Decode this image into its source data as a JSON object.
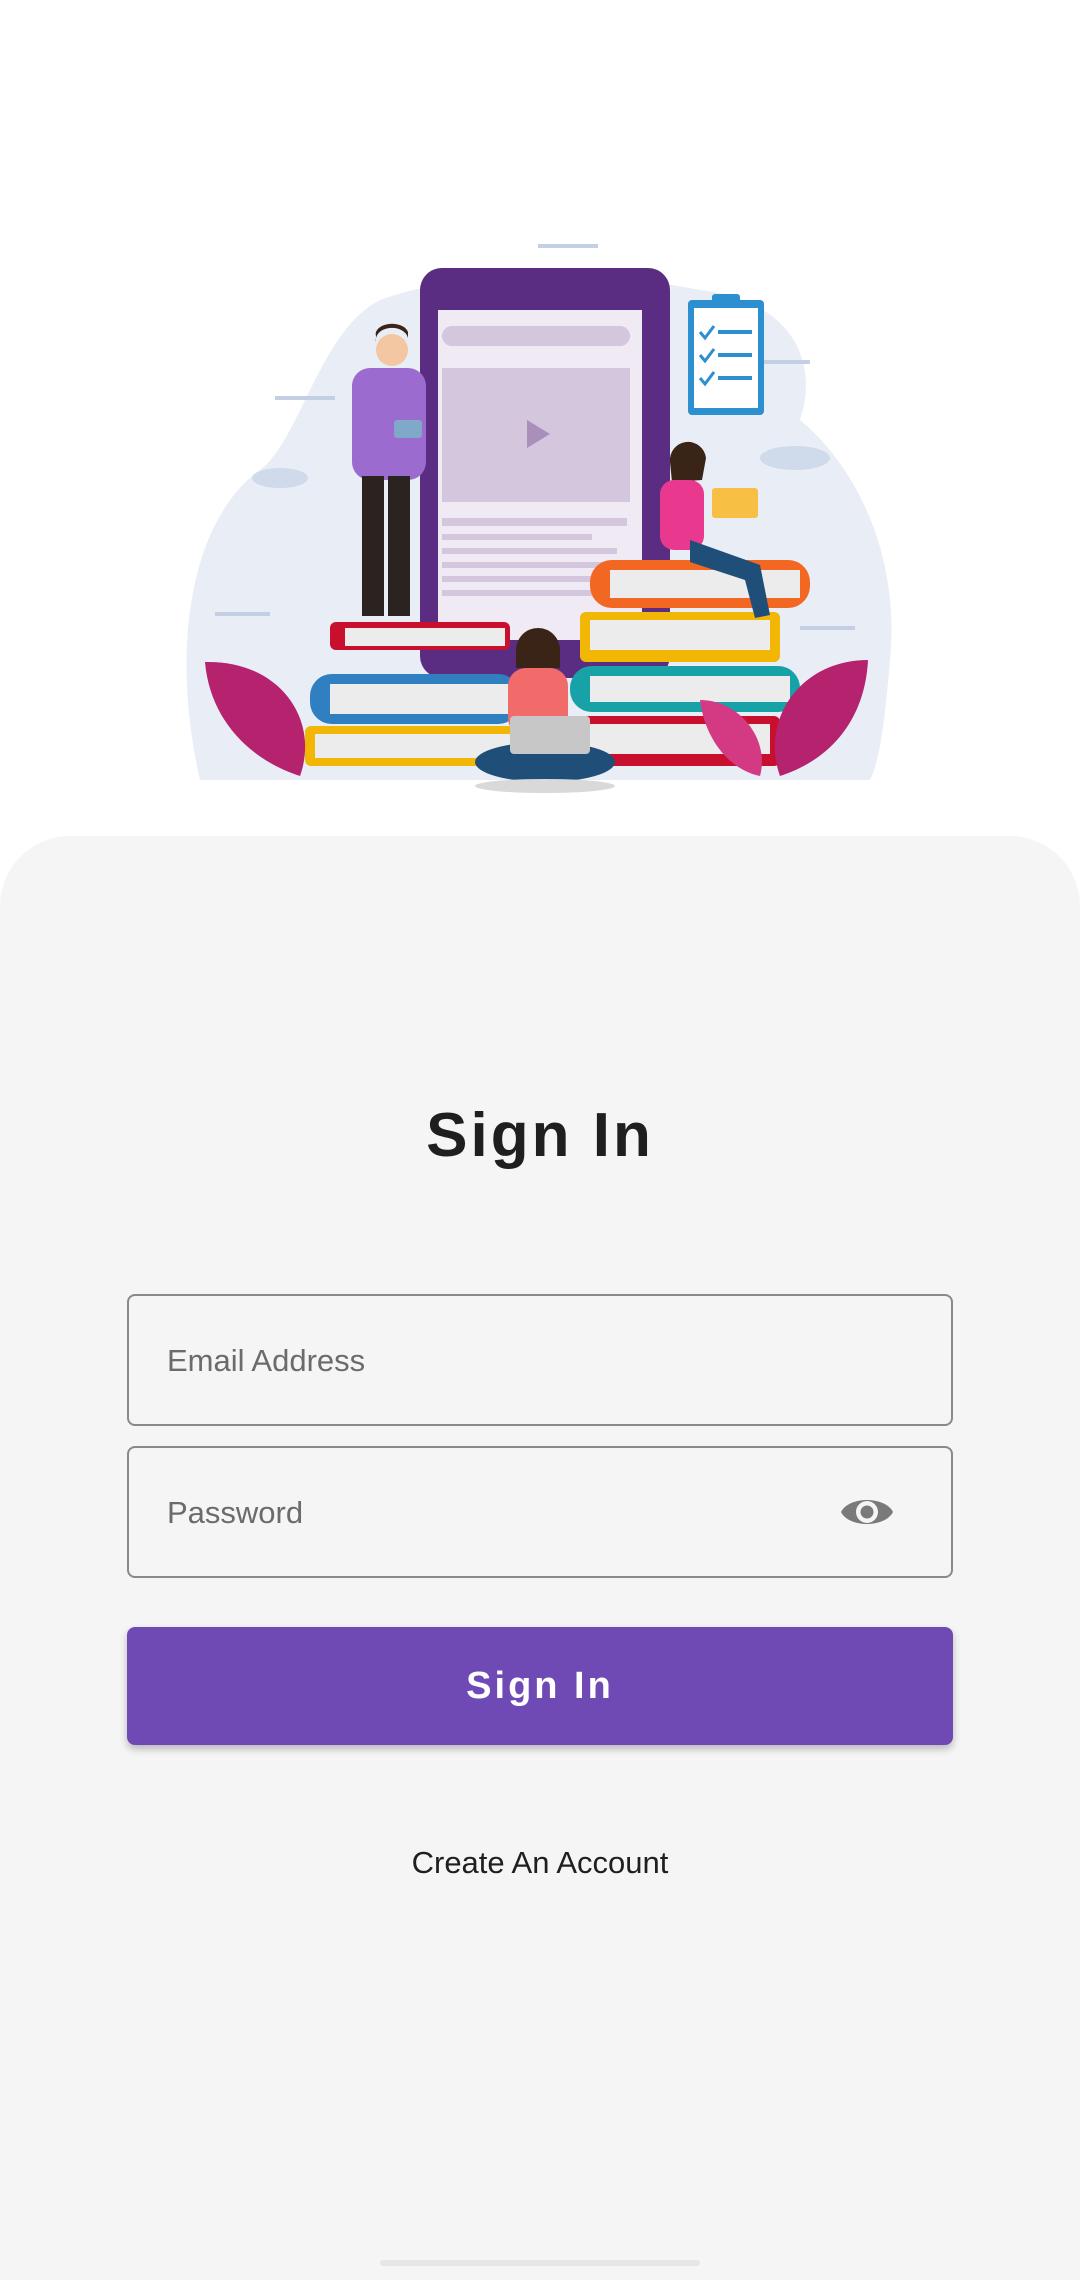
{
  "title": "Sign In",
  "email": {
    "placeholder": "Email Address",
    "value": ""
  },
  "password": {
    "placeholder": "Password",
    "value": "",
    "toggle_icon": "eye-icon"
  },
  "sign_in_button": {
    "label": "Sign In"
  },
  "create_account_link": {
    "label": "Create An Account"
  },
  "illustration": {
    "subject": "people reading around stacked books and a phone"
  },
  "colors": {
    "accent": "#6f4ab5",
    "sheet_background": "#f5f5f5",
    "page_background": "#ffffff",
    "text": "#1f1f1f"
  }
}
